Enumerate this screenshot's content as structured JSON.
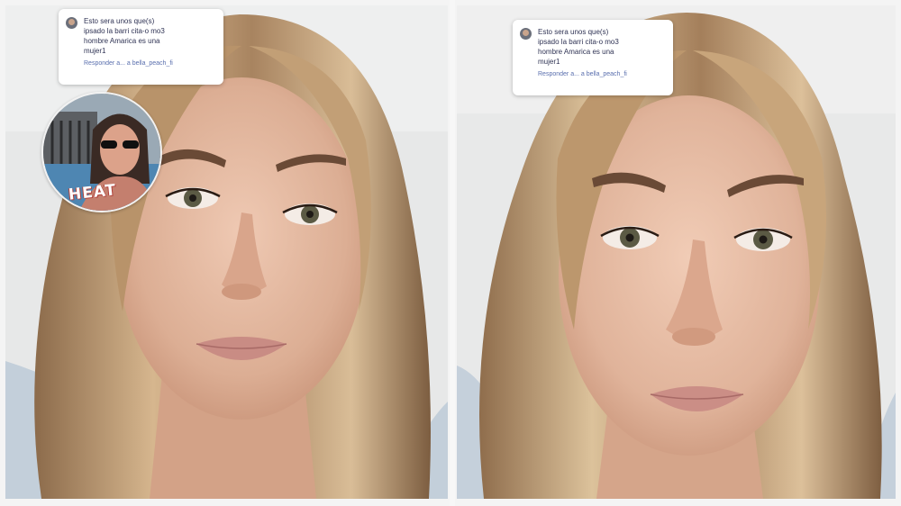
{
  "left_panel": {
    "caption": {
      "lines": [
        "Esto sera unos que(s)",
        "ipsado la barri cita-o mo3",
        "hombre Amarica es una",
        "mujer1"
      ],
      "reply": "Responder a... a bella_peach_fi"
    },
    "reaction_bubble": {
      "label": "HEAT"
    }
  },
  "right_panel": {
    "caption": {
      "lines": [
        "Esto sera unos que(s)",
        "ipsado la barri cita-o mo3",
        "hombre Amarica es una",
        "mujer1"
      ],
      "reply": "Responder a... a bella_peach_fi"
    }
  },
  "colors": {
    "background": "#e9eaea",
    "hair": "#b8936a",
    "skin": "#e2b79f",
    "lips": "#c98c84",
    "shirt": "#c9d4df"
  }
}
